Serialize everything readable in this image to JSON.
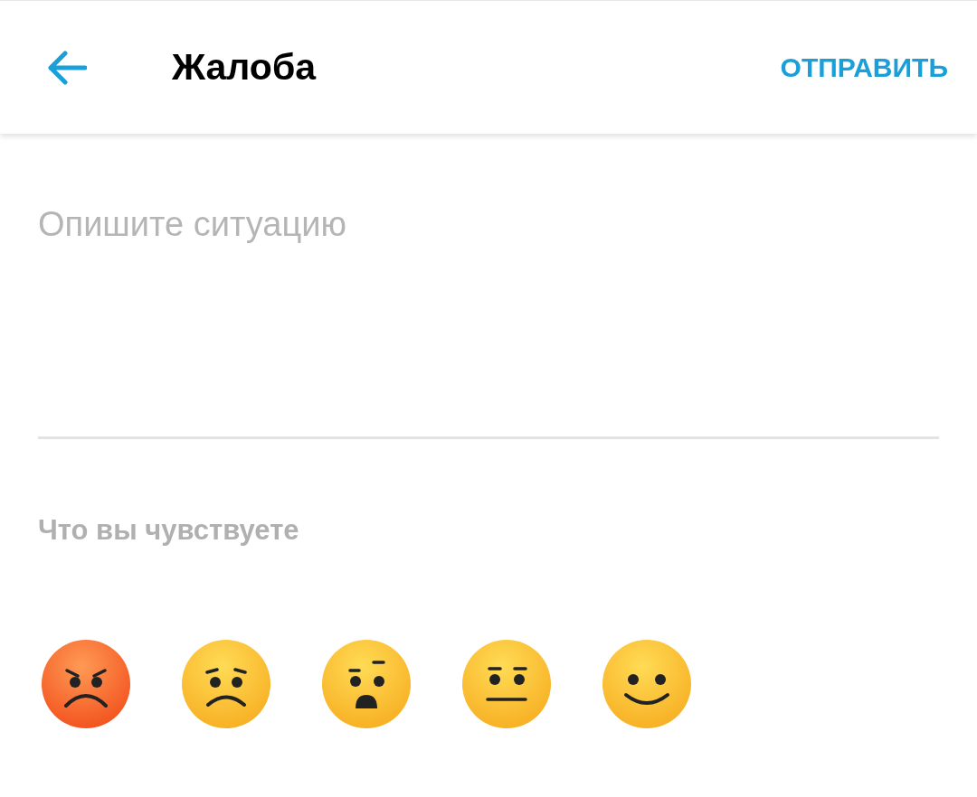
{
  "header": {
    "title": "Жалоба",
    "action": "ОТПРАВИТЬ"
  },
  "description": {
    "placeholder": "Опишите ситуацию"
  },
  "feelings": {
    "label": "Что вы чувствуете",
    "options": [
      {
        "kind": "angry"
      },
      {
        "kind": "sad"
      },
      {
        "kind": "worried"
      },
      {
        "kind": "neutral"
      },
      {
        "kind": "smile"
      }
    ]
  }
}
